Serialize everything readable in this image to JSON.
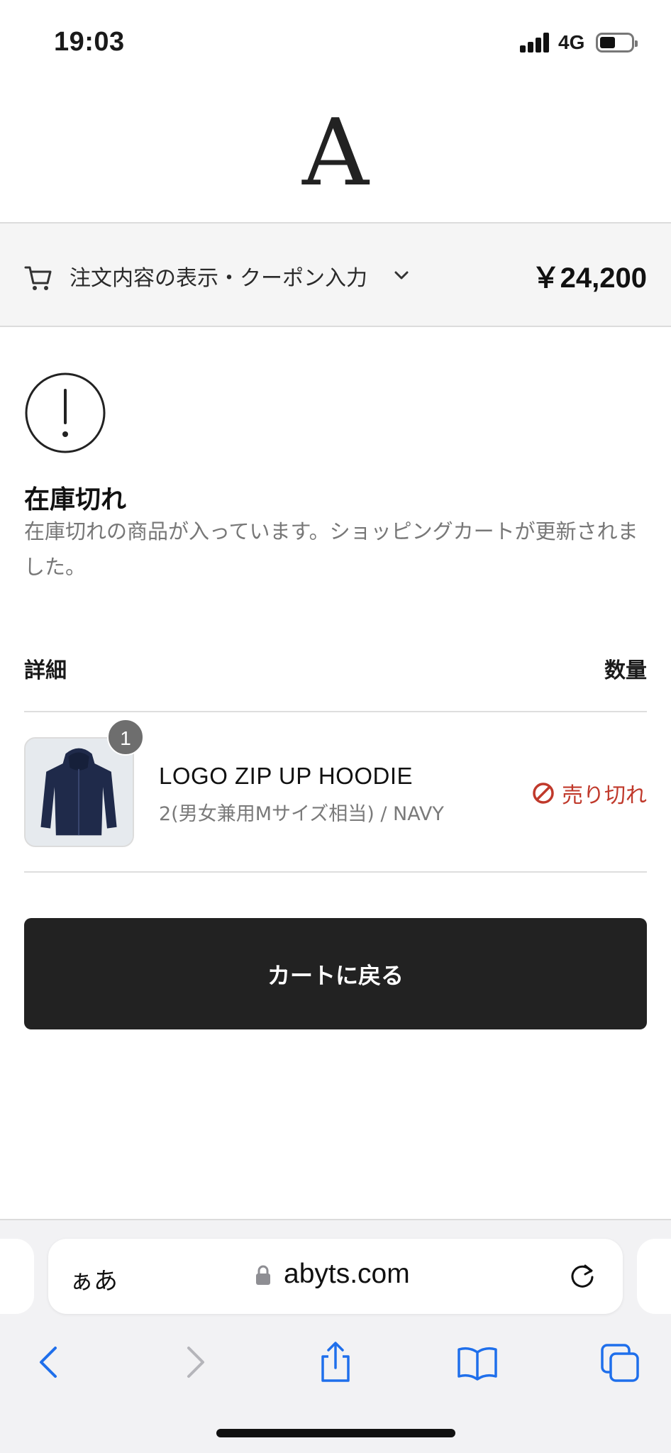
{
  "status_bar": {
    "time": "19:03",
    "network": "4G",
    "icons": [
      "signal-icon",
      "battery-icon"
    ]
  },
  "site": {
    "logo_text": "A"
  },
  "summary": {
    "label": "注文内容の表示・クーポン入力",
    "total": "￥24,200",
    "icons": [
      "cart-icon",
      "chevron-down-icon"
    ]
  },
  "notice": {
    "title": "在庫切れ",
    "message": "在庫切れの商品が入っています。ショッピングカートが更新されました。",
    "icon": "exclamation-circle-icon"
  },
  "table": {
    "col_detail": "詳細",
    "col_quantity": "数量",
    "items": [
      {
        "name": "LOGO ZIP UP HOODIE",
        "variant": "2(男女兼用Mサイズ相当) / NAVY",
        "quantity": "1",
        "status": "売り切れ",
        "status_icon": "prohibited-icon",
        "status_color": "#c0392b",
        "image": "navy-hoodie-thumbnail"
      }
    ]
  },
  "actions": {
    "back_to_cart": "カートに戻る"
  },
  "browser": {
    "aa_label": "ぁあ",
    "url": "abyts.com",
    "toolbar_icons": [
      "back-icon",
      "forward-icon",
      "share-icon",
      "bookmarks-icon",
      "tabs-icon"
    ],
    "accent_color": "#1f6feb"
  }
}
